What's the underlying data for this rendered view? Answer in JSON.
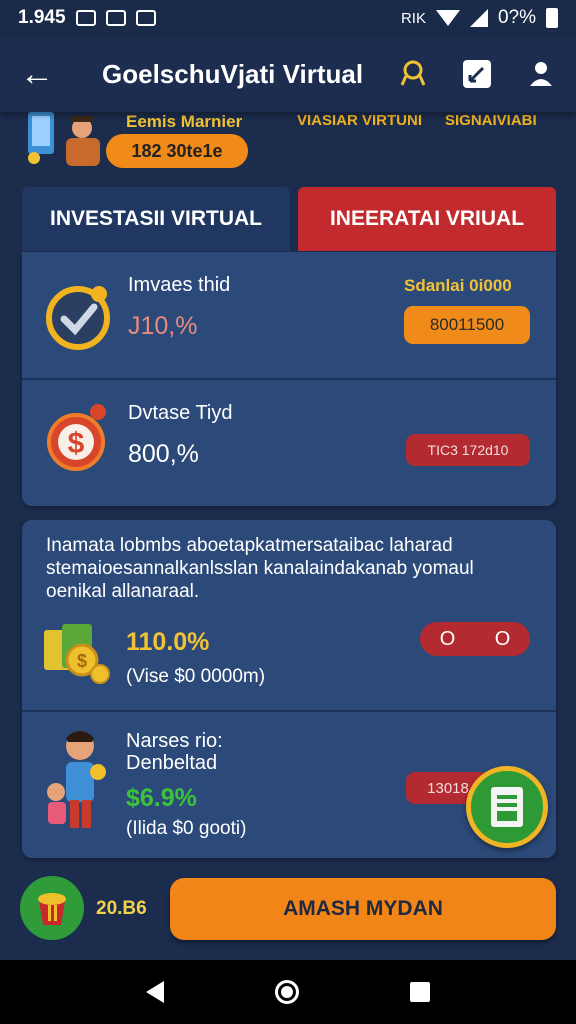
{
  "status": {
    "time": "1.945",
    "battery": "0?%",
    "extra": "RIK"
  },
  "appbar": {
    "title": "GoelschuVjati Virtual",
    "icons": [
      "back-arrow-icon",
      "award-icon",
      "edit-icon",
      "profile-icon"
    ]
  },
  "profile": {
    "name": "Eemis Marnier",
    "balance": "182 30te1e",
    "link1": "VIASIAR VIRTUNI",
    "link2": "SIGNAIVIABI"
  },
  "tabs": [
    {
      "label": "INVESTASII VIRTUAL",
      "active": true
    },
    {
      "label": "INEERATAI VRIUAL",
      "active": false
    }
  ],
  "investments": [
    {
      "title": "Imvaes thid",
      "value": "J10,%",
      "label": "Sdanlai 0i000",
      "badge": "80011500",
      "icon": "check-circle-icon",
      "badge_color": "orange"
    },
    {
      "title": "Dvtase Tiyd",
      "value": "800,%",
      "badge": "TIC3 172d10",
      "icon": "dollar-circle-icon",
      "badge_color": "red"
    }
  ],
  "info": {
    "desc": "Inamata lobmbs aboetapkatmersataibac laharad stemaioesannalkanlsslan kanalaindakanab yomaul oenikal allanaraal.",
    "rows": [
      {
        "value": "110.0%",
        "sub": "(Vise $0 0000m)",
        "toggle": [
          "O",
          "O"
        ],
        "icon": "gold-coins-icon"
      },
      {
        "title": "Narses rio:",
        "title2": "Denbeltad",
        "value": "$6.9%",
        "sub": "(Ilida $0 gooti)",
        "badge": "13018",
        "icon": "family-icon"
      }
    ]
  },
  "bottom": {
    "value": "20.B6",
    "cta": "AMASH MYDAN"
  },
  "colors": {
    "orange": "#f08a18",
    "red": "#c22a2e",
    "green": "#3cc33c",
    "gold": "#f1c233"
  }
}
